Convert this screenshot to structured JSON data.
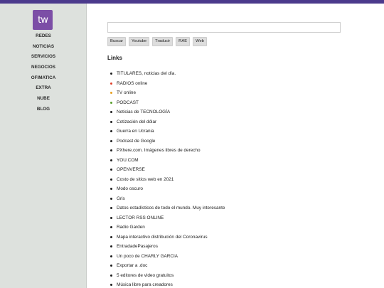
{
  "logo": {
    "text": "tw",
    "color": "#7c4ea6"
  },
  "colors": {
    "topbar": "#4b3a8c",
    "sidebar": "#dde1dd"
  },
  "sidebar": {
    "items": [
      "REDES",
      "NOTICIAS",
      "SERVICIOS",
      "NEGOCIOS",
      "OFIMATICA",
      "EXTRA",
      "NUBE",
      "BLOG"
    ]
  },
  "search": {
    "value": "",
    "placeholder": ""
  },
  "buttons": [
    "Buscar",
    "Youtube",
    "Traducir",
    "RAE",
    "Web"
  ],
  "links_title": "Links",
  "links": [
    {
      "label": "TITULARES, noticias del día.",
      "bullet": "#222222"
    },
    {
      "label": "RADIOS online",
      "bullet": "#e0402a"
    },
    {
      "label": "TV online",
      "bullet": "#e8a020"
    },
    {
      "label": "PODCAST",
      "bullet": "#5aa02c"
    },
    {
      "label": "Noticias de TECNOLOGÍA",
      "bullet": "#222222"
    },
    {
      "label": "Cotización del dólar",
      "bullet": "#222222"
    },
    {
      "label": "Guerra en Ucrania",
      "bullet": "#222222"
    },
    {
      "label": "Podcast de Google",
      "bullet": "#222222"
    },
    {
      "label": "PXhere.com. Imágenes libres de derecho",
      "bullet": "#222222"
    },
    {
      "label": "YOU.COM",
      "bullet": "#222222"
    },
    {
      "label": "OPENVERSE",
      "bullet": "#222222"
    },
    {
      "label": "Costo de sitios web en 2021",
      "bullet": "#222222"
    },
    {
      "label": "Modo oscuro",
      "bullet": "#222222"
    },
    {
      "label": "Gris",
      "bullet": "#222222"
    },
    {
      "label": "Datos estadísticos de todo el mundo. Muy interesante",
      "bullet": "#222222"
    },
    {
      "label": "LECTOR RSS ONLINE",
      "bullet": "#222222"
    },
    {
      "label": "Radio Garden",
      "bullet": "#222222"
    },
    {
      "label": "Mapa interactivo distribución del Coronavirus",
      "bullet": "#222222"
    },
    {
      "label": "EntradadePasajeros",
      "bullet": "#222222"
    },
    {
      "label": "Un poco de CHARLY GARCIA",
      "bullet": "#222222"
    },
    {
      "label": "Exportar a .doc",
      "bullet": "#222222"
    },
    {
      "label": "5 editores de video gratuitos",
      "bullet": "#222222"
    },
    {
      "label": "Música libre para creadores",
      "bullet": "#222222"
    }
  ]
}
